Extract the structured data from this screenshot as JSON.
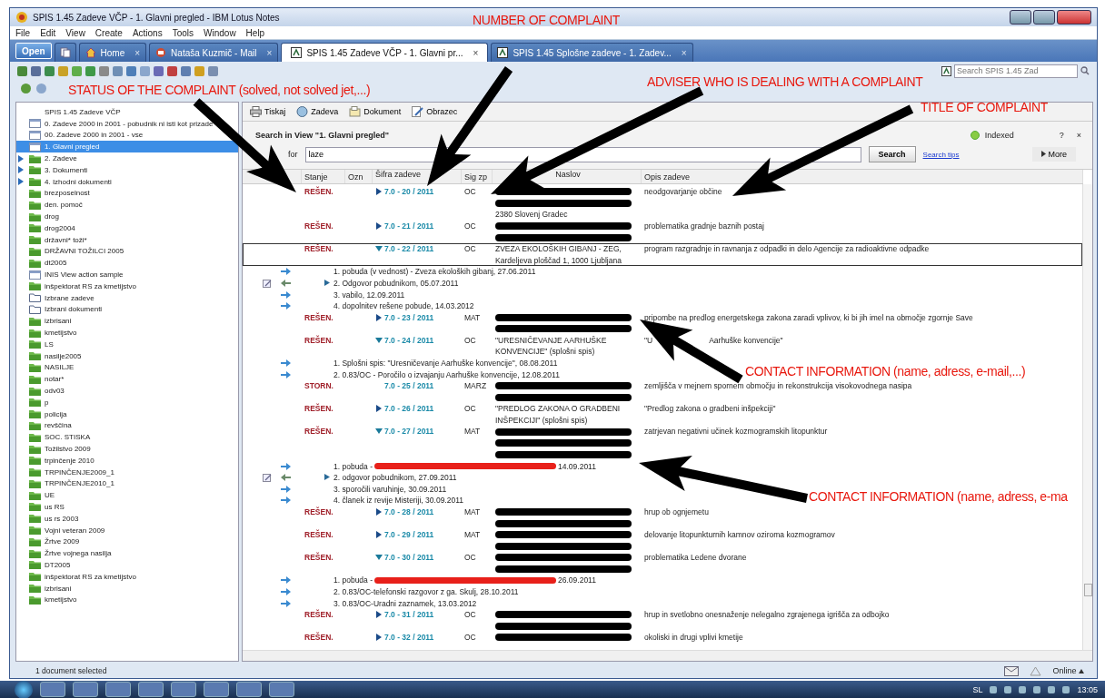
{
  "window": {
    "title": "SPIS 1.45 Zadeve VČP - 1. Glavni pregled - IBM Lotus Notes"
  },
  "menu": [
    "File",
    "Edit",
    "View",
    "Create",
    "Actions",
    "Tools",
    "Window",
    "Help"
  ],
  "open_button": "Open",
  "tabs": [
    {
      "label": "Home",
      "kind": "home",
      "close": "×",
      "selected": false
    },
    {
      "label": "Nataša Kuzmič - Mail",
      "kind": "mail",
      "close": "×",
      "selected": false
    },
    {
      "label": "SPIS 1.45 Zadeve VČP - 1. Glavni pr...",
      "kind": "database",
      "close": "×",
      "selected": true
    },
    {
      "label": "SPIS 1.45 Splošne zadeve - 1. Zadev...",
      "kind": "database",
      "close": "×",
      "selected": false
    }
  ],
  "search_box": {
    "placeholder": "Search SPIS 1.45 Zad"
  },
  "sidebar": {
    "items": [
      {
        "label": "SPIS 1.45 Zadeve VČP",
        "kind": "header",
        "selected": false,
        "expandable": false
      },
      {
        "label": "0. Zadeve 2000 in 2001 - pobudnik ni isti kot prizade",
        "kind": "view",
        "selected": false,
        "expandable": false
      },
      {
        "label": "00. Zadeve 2000 in 2001 - vse",
        "kind": "view",
        "selected": false,
        "expandable": false
      },
      {
        "label": "1. Glavni pregled",
        "kind": "view",
        "selected": true,
        "expandable": false
      },
      {
        "label": "2. Zadeve",
        "kind": "folder",
        "selected": false,
        "expandable": true
      },
      {
        "label": "3. Dokumenti",
        "kind": "folder",
        "selected": false,
        "expandable": true
      },
      {
        "label": "4. Izhodni dokumenti",
        "kind": "folder",
        "selected": false,
        "expandable": true
      },
      {
        "label": "brezposelnost",
        "kind": "folder",
        "selected": false,
        "expandable": false
      },
      {
        "label": "den. pomoč",
        "kind": "folder",
        "selected": false,
        "expandable": false
      },
      {
        "label": "drog",
        "kind": "folder",
        "selected": false,
        "expandable": false
      },
      {
        "label": "drog2004",
        "kind": "folder",
        "selected": false,
        "expandable": false
      },
      {
        "label": "državni* toži*",
        "kind": "folder",
        "selected": false,
        "expandable": false
      },
      {
        "label": "DRŽAVNI TOŽILCI 2005",
        "kind": "folder",
        "selected": false,
        "expandable": false
      },
      {
        "label": "dt2005",
        "kind": "folder",
        "selected": false,
        "expandable": false
      },
      {
        "label": "INIS View action sample",
        "kind": "view",
        "selected": false,
        "expandable": false
      },
      {
        "label": "inšpektorat RS za kmetijstvo",
        "kind": "folder",
        "selected": false,
        "expandable": false
      },
      {
        "label": "Izbrane zadeve",
        "kind": "empty-folder",
        "selected": false,
        "expandable": false
      },
      {
        "label": "Izbrani dokumenti",
        "kind": "empty-folder",
        "selected": false,
        "expandable": false
      },
      {
        "label": "izbrisani",
        "kind": "folder",
        "selected": false,
        "expandable": false
      },
      {
        "label": "kmetijstvo",
        "kind": "folder",
        "selected": false,
        "expandable": false
      },
      {
        "label": "LS",
        "kind": "folder",
        "selected": false,
        "expandable": false
      },
      {
        "label": "nasilje2005",
        "kind": "folder",
        "selected": false,
        "expandable": false
      },
      {
        "label": "NASILJE",
        "kind": "folder",
        "selected": false,
        "expandable": false
      },
      {
        "label": "notar*",
        "kind": "folder",
        "selected": false,
        "expandable": false
      },
      {
        "label": "odv03",
        "kind": "folder",
        "selected": false,
        "expandable": false
      },
      {
        "label": "p",
        "kind": "folder",
        "selected": false,
        "expandable": false
      },
      {
        "label": "policija",
        "kind": "folder",
        "selected": false,
        "expandable": false
      },
      {
        "label": "revščina",
        "kind": "folder",
        "selected": false,
        "expandable": false
      },
      {
        "label": "SOC. STISKA",
        "kind": "folder",
        "selected": false,
        "expandable": false
      },
      {
        "label": "Tožilstvo 2009",
        "kind": "folder",
        "selected": false,
        "expandable": false
      },
      {
        "label": "trpinčenje 2010",
        "kind": "folder",
        "selected": false,
        "expandable": false
      },
      {
        "label": "TRPINČENJE2009_1",
        "kind": "folder",
        "selected": false,
        "expandable": false
      },
      {
        "label": "TRPINČENJE2010_1",
        "kind": "folder",
        "selected": false,
        "expandable": false
      },
      {
        "label": "UE",
        "kind": "folder",
        "selected": false,
        "expandable": false
      },
      {
        "label": "us RS",
        "kind": "folder",
        "selected": false,
        "expandable": false
      },
      {
        "label": "us rs 2003",
        "kind": "folder",
        "selected": false,
        "expandable": false
      },
      {
        "label": "Vojni veteran 2009",
        "kind": "folder",
        "selected": false,
        "expandable": false
      },
      {
        "label": "Žrtve 2009",
        "kind": "folder",
        "selected": false,
        "expandable": false
      },
      {
        "label": "Žrtve vojnega nasilja",
        "kind": "folder",
        "selected": false,
        "expandable": false
      },
      {
        "label": "DT2005",
        "kind": "folder",
        "selected": false,
        "expandable": false
      },
      {
        "label": "inšpektorat RS za kmetijstvo",
        "kind": "folder",
        "selected": false,
        "expandable": false
      },
      {
        "label": "izbrisani",
        "kind": "folder",
        "selected": false,
        "expandable": false
      },
      {
        "label": "kmetijstvo",
        "kind": "folder",
        "selected": false,
        "expandable": false
      }
    ]
  },
  "action_buttons": [
    {
      "label": "Tiskaj",
      "kind": "print"
    },
    {
      "label": "Zadeva",
      "kind": "case"
    },
    {
      "label": "Dokument",
      "kind": "document"
    },
    {
      "label": "Obrazec",
      "kind": "form"
    }
  ],
  "search_panel": {
    "title": "Search in View \"1. Glavni pregled\"",
    "status": "Indexed",
    "help": "?",
    "close": "×",
    "label": "for",
    "value": "laze",
    "button": "Search",
    "tips": "Search tips",
    "more": "More"
  },
  "columns": [
    "Stanje",
    "Ozn",
    "Šifra zadeve",
    "Sig zp",
    "Naslov",
    "Opis zadeve"
  ],
  "rows": [
    {
      "kind": "case",
      "status": "REŠEN.",
      "expandable": true,
      "expanded": false,
      "code": "7.0 - 20 / 2011",
      "sig": "OC",
      "naslov": [
        {
          "kind": "redacted"
        },
        {
          "kind": "redacted"
        },
        {
          "kind": "text",
          "text": "2380 Slovenj Gradec"
        }
      ],
      "opis": "neodgovarjanje občine",
      "selected": false
    },
    {
      "kind": "case",
      "status": "REŠEN.",
      "expandable": true,
      "expanded": false,
      "code": "7.0 - 21 / 2011",
      "sig": "OC",
      "naslov": [
        {
          "kind": "redacted"
        },
        {
          "kind": "redacted"
        }
      ],
      "opis": "problematika gradnje baznih postaj",
      "selected": false
    },
    {
      "kind": "case",
      "status": "REŠEN.",
      "expandable": true,
      "expanded": true,
      "code": "7.0 - 22 / 2011",
      "sig": "OC",
      "naslov": [
        {
          "kind": "text",
          "text": "ZVEZA EKOLOŠKIH GIBANJ - ZEG,"
        },
        {
          "kind": "text",
          "text": "Kardeljeva ploščad 1, 1000 Ljubljana"
        }
      ],
      "opis": "program razgradnje in ravnanja z odpadki in delo Agencije za radioaktivne odpadke",
      "selected": true
    },
    {
      "kind": "document",
      "outgoing": false,
      "note": false,
      "has_children": false,
      "text": "1. pobuda (v vednost) - Zveza ekoloških gibanj, 27.06.2011",
      "redacted": false
    },
    {
      "kind": "document",
      "outgoing": true,
      "note": true,
      "has_children": true,
      "text": "2. Odgovor pobudnikom, 05.07.2011",
      "redacted": false
    },
    {
      "kind": "document",
      "outgoing": false,
      "note": false,
      "has_children": false,
      "text": "3. vabilo, 12.09.2011",
      "redacted": false
    },
    {
      "kind": "document",
      "outgoing": false,
      "note": false,
      "has_children": false,
      "text": "4. dopolnitev rešene pobude, 14.03.2012",
      "redacted": false
    },
    {
      "kind": "case",
      "status": "REŠEN.",
      "expandable": true,
      "expanded": false,
      "code": "7.0 - 23 / 2011",
      "sig": "MAT",
      "naslov": [
        {
          "kind": "redacted"
        },
        {
          "kind": "redacted"
        }
      ],
      "opis": "pripombe na predlog energetskega zakona zaradi vplivov, ki bi jih imel na območje zgornje Save",
      "selected": false
    },
    {
      "kind": "case",
      "status": "REŠEN.",
      "expandable": true,
      "expanded": true,
      "code": "7.0 - 24 / 2011",
      "sig": "OC",
      "naslov": [
        {
          "kind": "text",
          "text": "\"URESNIČEVANJE AARHUŠKE"
        },
        {
          "kind": "text",
          "text": "KONVENCIJE\" (splošni spis)"
        }
      ],
      "opis": "\"U",
      "opis_after": "Aarhuške konvencije\"",
      "selected": false
    },
    {
      "kind": "document",
      "outgoing": false,
      "note": false,
      "has_children": false,
      "text": "1. Splošni spis: \"Uresničevanje Aarhuške konvencije\", 08.08.2011",
      "redacted": false
    },
    {
      "kind": "document",
      "outgoing": false,
      "note": false,
      "has_children": false,
      "text": "2. 0.83/OC - Poročilo o izvajanju Aarhuške konvencije, 12.08.2011",
      "redacted": false
    },
    {
      "kind": "case",
      "status": "STORN.",
      "expandable": false,
      "code": "7.0 - 25 / 2011",
      "sig": "MARZ",
      "naslov": [
        {
          "kind": "redacted"
        },
        {
          "kind": "redacted"
        }
      ],
      "opis": "zemljišča v mejnem spornem območju in rekonstrukcija visokovodnega nasipa",
      "selected": false
    },
    {
      "kind": "case",
      "status": "REŠEN.",
      "expandable": true,
      "expanded": false,
      "code": "7.0 - 26 / 2011",
      "sig": "OC",
      "naslov": [
        {
          "kind": "text",
          "text": "\"PREDLOG ZAKONA O GRADBENI"
        },
        {
          "kind": "text",
          "text": "INŠPEKCIJI\" (splošni spis)"
        }
      ],
      "opis": "\"Predlog zakona o gradbeni inšpekciji\"",
      "selected": false
    },
    {
      "kind": "case",
      "status": "REŠEN.",
      "expandable": true,
      "expanded": true,
      "code": "7.0 - 27 / 2011",
      "sig": "MAT",
      "naslov": [
        {
          "kind": "redacted"
        },
        {
          "kind": "redacted"
        },
        {
          "kind": "redacted"
        }
      ],
      "opis": "zatrjevan negativni učinek kozmogramskih litopunktur",
      "selected": false
    },
    {
      "kind": "document",
      "outgoing": false,
      "note": false,
      "has_children": false,
      "text": "1. pobuda - ",
      "redacted": true,
      "text_after": "14.09.2011"
    },
    {
      "kind": "document",
      "outgoing": true,
      "note": true,
      "has_children": true,
      "text": "2. odgovor pobudnikom, 27.09.2011",
      "redacted": false
    },
    {
      "kind": "document",
      "outgoing": false,
      "note": false,
      "has_children": false,
      "text": "3. sporočili varuhinje, 30.09.2011",
      "redacted": false
    },
    {
      "kind": "document",
      "outgoing": false,
      "note": false,
      "has_children": false,
      "text": "4. članek iz revije Misteriji, 30.09.2011",
      "redacted": false
    },
    {
      "kind": "case",
      "status": "REŠEN.",
      "expandable": true,
      "expanded": false,
      "code": "7.0 - 28 / 2011",
      "sig": "MAT",
      "naslov": [
        {
          "kind": "redacted"
        },
        {
          "kind": "redacted"
        }
      ],
      "opis": "hrup ob ognjemetu",
      "selected": false
    },
    {
      "kind": "case",
      "status": "REŠEN.",
      "expandable": true,
      "expanded": false,
      "code": "7.0 - 29 / 2011",
      "sig": "MAT",
      "naslov": [
        {
          "kind": "redacted"
        },
        {
          "kind": "redacted"
        }
      ],
      "opis": "delovanje litopunkturnih kamnov oziroma kozmogramov",
      "selected": false
    },
    {
      "kind": "case",
      "status": "REŠEN.",
      "expandable": true,
      "expanded": true,
      "code": "7.0 - 30 / 2011",
      "sig": "OC",
      "naslov": [
        {
          "kind": "redacted"
        },
        {
          "kind": "redacted"
        }
      ],
      "opis": "problematika Ledene dvorane",
      "selected": false
    },
    {
      "kind": "document",
      "outgoing": false,
      "note": false,
      "has_children": false,
      "text": "1. pobuda - ",
      "redacted": true,
      "text_after": "26.09.2011"
    },
    {
      "kind": "document",
      "outgoing": false,
      "note": false,
      "has_children": false,
      "text": "2. 0.83/OC-telefonski razgovor z ga. Skulj, 28.10.2011",
      "redacted": false
    },
    {
      "kind": "document",
      "outgoing": false,
      "note": false,
      "has_children": false,
      "text": "3. 0.83/OC-Uradni zaznamek, 13.03.2012",
      "redacted": false
    },
    {
      "kind": "case",
      "status": "REŠEN.",
      "expandable": true,
      "expanded": false,
      "code": "7.0 - 31 / 2011",
      "sig": "OC",
      "naslov": [
        {
          "kind": "redacted"
        },
        {
          "kind": "redacted"
        }
      ],
      "opis": "hrup in svetlobno onesnaženje nelegalno zgrajenega igrišča za odbojko",
      "selected": false
    },
    {
      "kind": "case",
      "status": "REŠEN.",
      "expandable": true,
      "expanded": false,
      "code": "7.0 - 32 / 2011",
      "sig": "OC",
      "naslov": [
        {
          "kind": "redacted"
        }
      ],
      "opis": "okoliski in drugi vplivi kmetije",
      "selected": false
    }
  ],
  "status_bar": {
    "text": "1 document selected",
    "online": "Online"
  },
  "taskbar": {
    "language": "SL",
    "time": "13:05"
  },
  "annotations": [
    "NUMBER OF COMPLAINT",
    "STATUS OF THE COMPLAINT (solved, not solved jet,...)",
    "ADVISER WHO IS DEALING WITH A COMPLAINT",
    "TITLE OF COMPLAINT",
    "CONTACT INFORMATION (name, adress, e-mail,...)",
    "CONTACT INFORMATION (name, adress, e-ma"
  ]
}
